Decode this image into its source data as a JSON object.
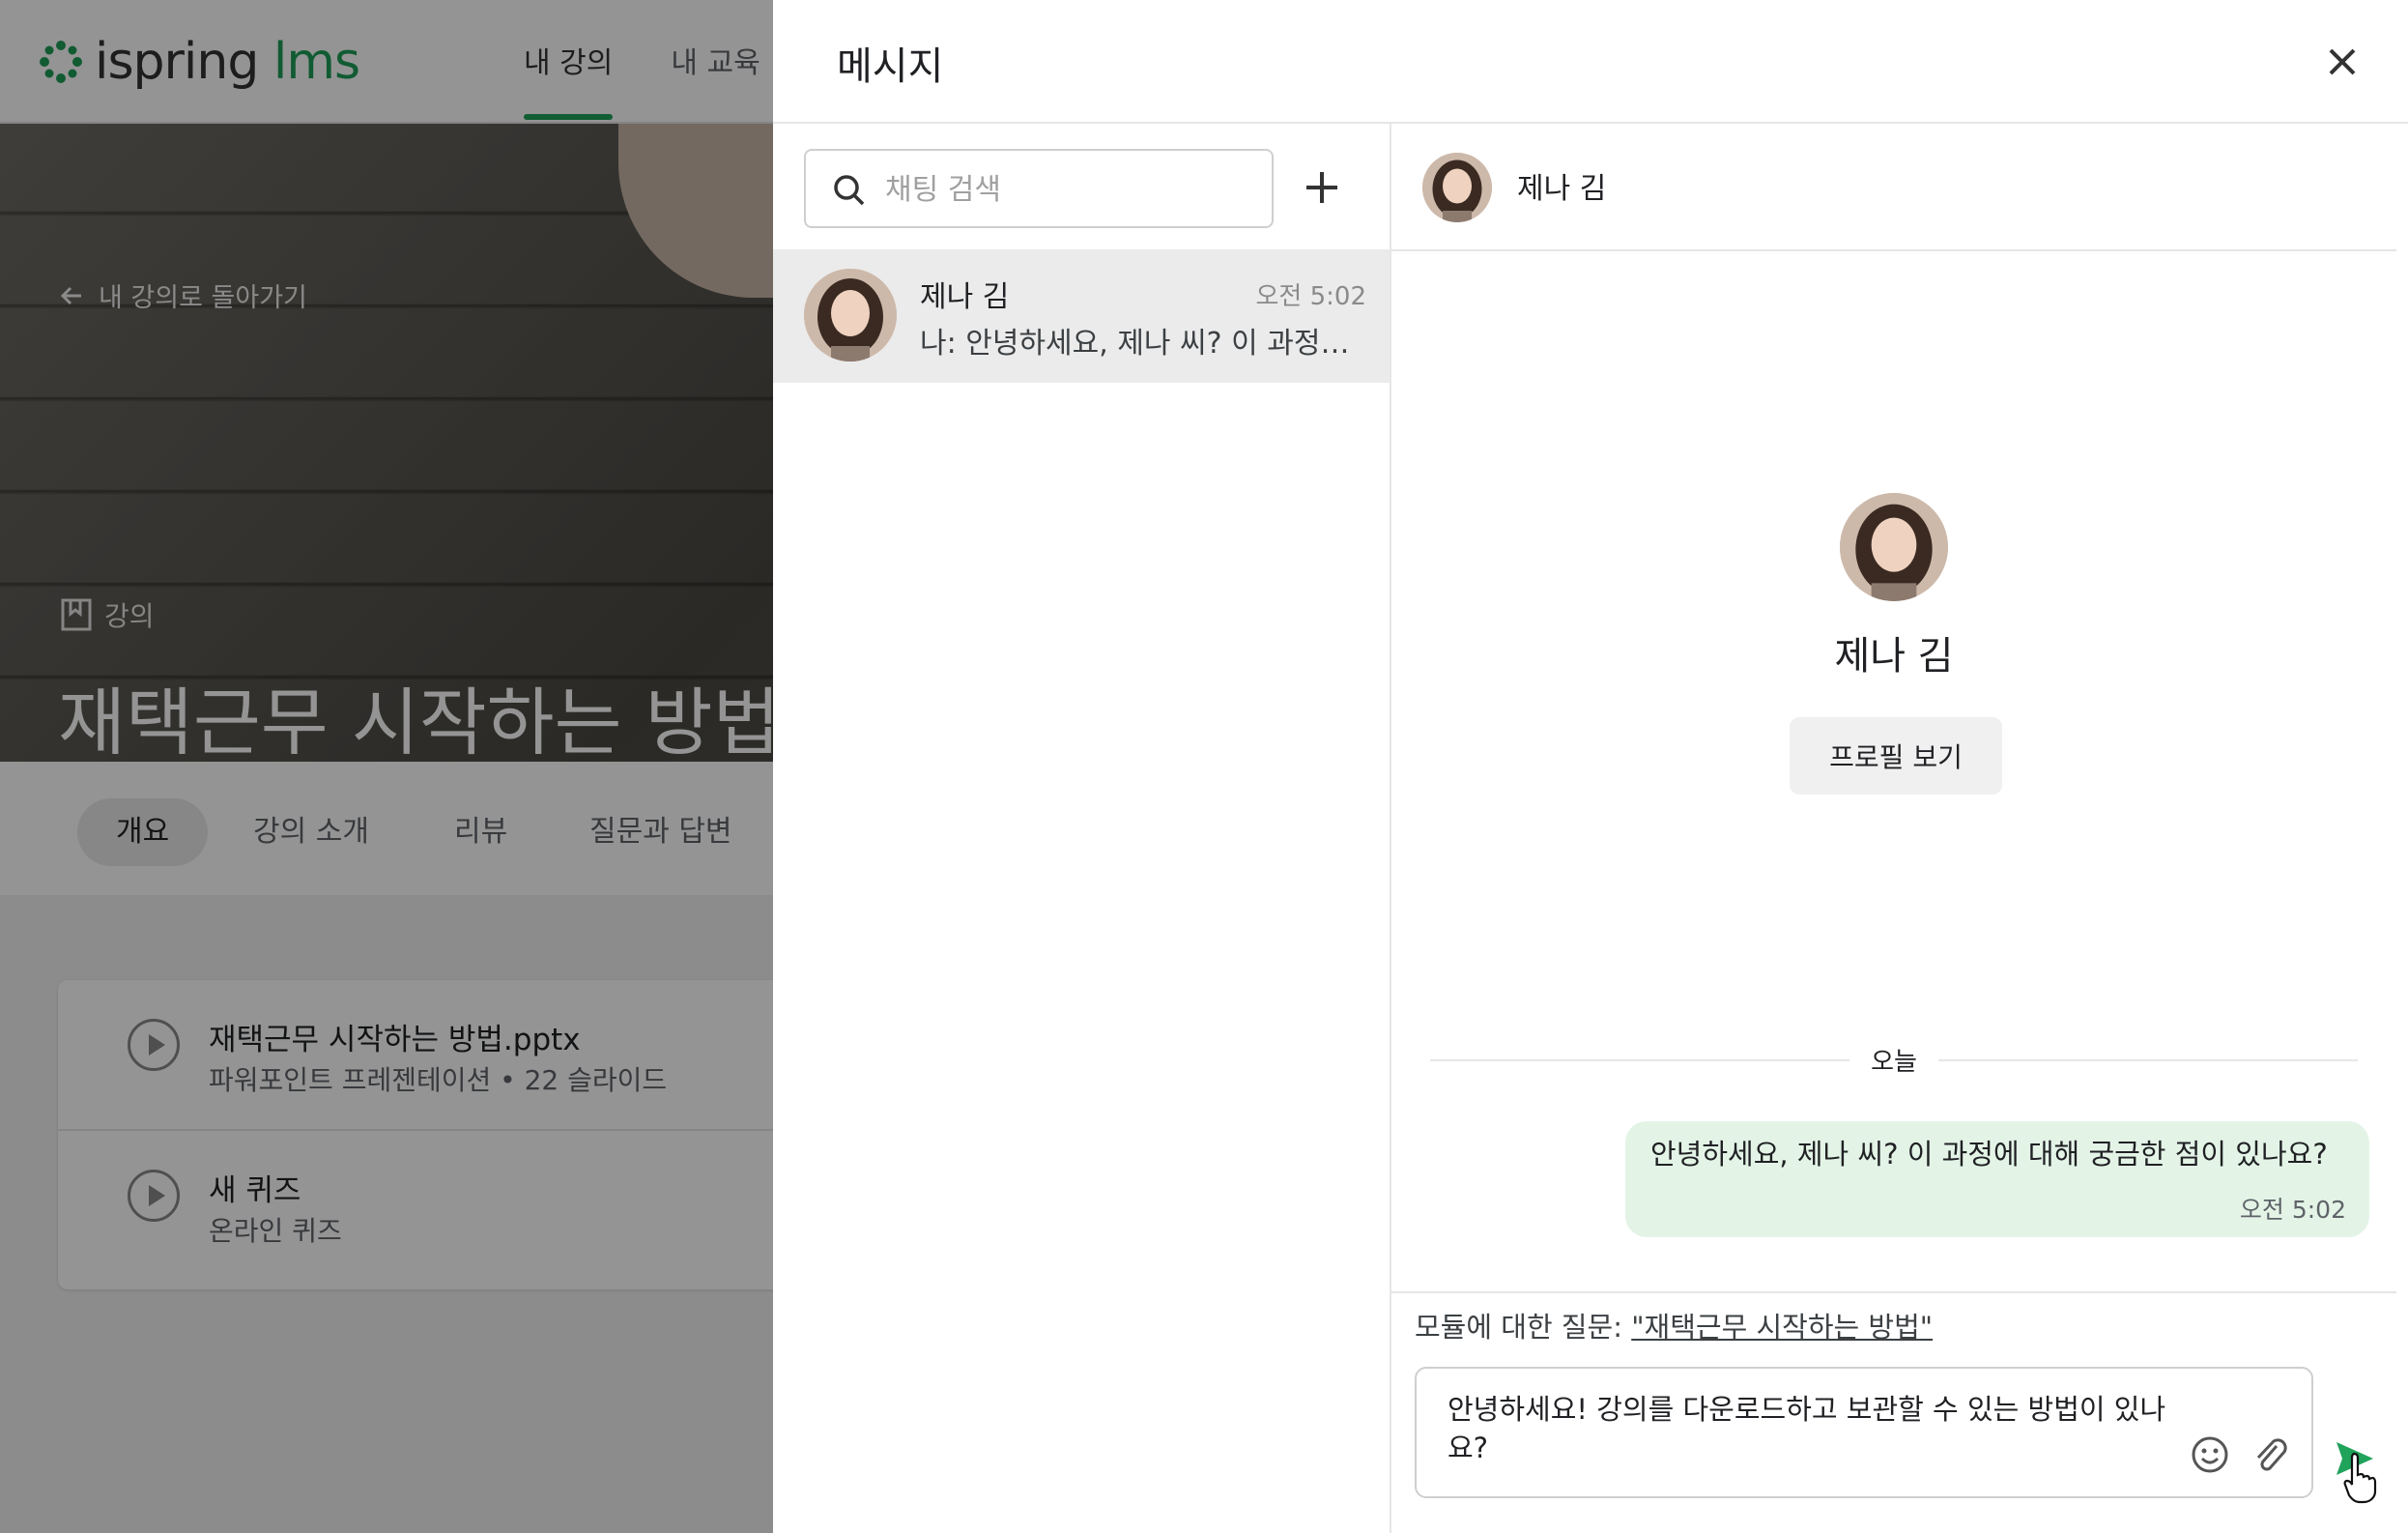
{
  "app": {
    "logo_word": "ispring",
    "logo_suffix": "lms",
    "nav": [
      "내 강의",
      "내 교육"
    ]
  },
  "course": {
    "back_label": "내 강의로 돌아가기",
    "tag": "강의",
    "title": "재택근무 시작하는 방법",
    "tabs": [
      "개요",
      "강의 소개",
      "리뷰",
      "질문과 답변"
    ],
    "modules": [
      {
        "name": "재택근무 시작하는 방법.pptx",
        "meta": "파워포인트 프레젠테이션  •  22 슬라이드"
      },
      {
        "name": "새 퀴즈",
        "meta": "온라인 퀴즈"
      }
    ]
  },
  "messages": {
    "title": "메시지",
    "search_placeholder": "채팅 검색",
    "conversations": [
      {
        "name": "제나 김",
        "time": "오전 5:02",
        "preview": "나: 안녕하세요, 제나 씨? 이 과정에 대해 궁금한 점이 있나요?"
      }
    ],
    "chat": {
      "name": "제나 김",
      "profile_button": "프로필 보기",
      "day_label": "오늘",
      "message_text": "안녕하세요, 제나 씨? 이 과정에 대해 궁금한 점이 있나요?",
      "message_time": "오전 5:02",
      "context_prefix": "모듈에 대한 질문: ",
      "context_link": "\"재택근무 시작하는 방법\"",
      "draft": "안녕하세요! 강의를 다운로드하고 보관할 수 있는 방법이 있나요?"
    }
  },
  "colors": {
    "accent": "#20a35a",
    "bubble": "#e3f4e7",
    "selected_row": "#ebebeb"
  },
  "icons": [
    "search-icon",
    "plus-icon",
    "close-icon",
    "emoji-icon",
    "attach-icon",
    "send-icon",
    "back-arrow-icon",
    "book-icon",
    "play-icon"
  ]
}
